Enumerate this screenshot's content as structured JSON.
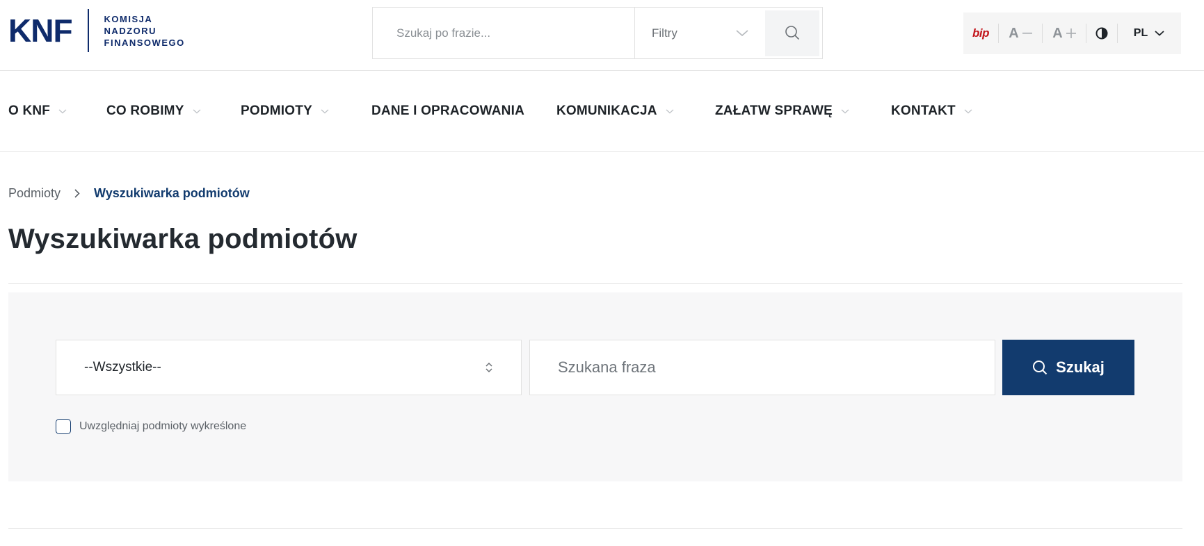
{
  "brand": {
    "mark": "KNF",
    "line1": "KOMISJA",
    "line2": "NADZORU",
    "line3": "FINANSOWEGO",
    "color": "#0f2b6b"
  },
  "header_search": {
    "placeholder": "Szukaj po frazie...",
    "filter_label": "Filtry"
  },
  "toolbar": {
    "bip_label": "bip",
    "font_decrease": "A",
    "font_increase": "A",
    "language": "PL"
  },
  "nav": {
    "items": [
      {
        "label": "O KNF"
      },
      {
        "label": "CO ROBIMY"
      },
      {
        "label": "PODMIOTY"
      },
      {
        "label": "DANE I OPRACOWANIA"
      },
      {
        "label": "KOMUNIKACJA"
      },
      {
        "label": "ZAŁATW SPRAWĘ"
      },
      {
        "label": "KONTAKT"
      }
    ]
  },
  "breadcrumb": {
    "parent": "Podmioty",
    "current": "Wyszukiwarka podmiotów"
  },
  "page": {
    "title": "Wyszukiwarka podmiotów"
  },
  "search_form": {
    "select_value": "--Wszystkie--",
    "phrase_placeholder": "Szukana fraza",
    "button_label": "Szukaj",
    "checkbox_label": "Uwzględniaj podmioty wykreślone",
    "checkbox_checked": false
  },
  "colors": {
    "primary": "#123b6e",
    "bip": "#c3161c",
    "panel_bg": "#f7f7f8"
  }
}
